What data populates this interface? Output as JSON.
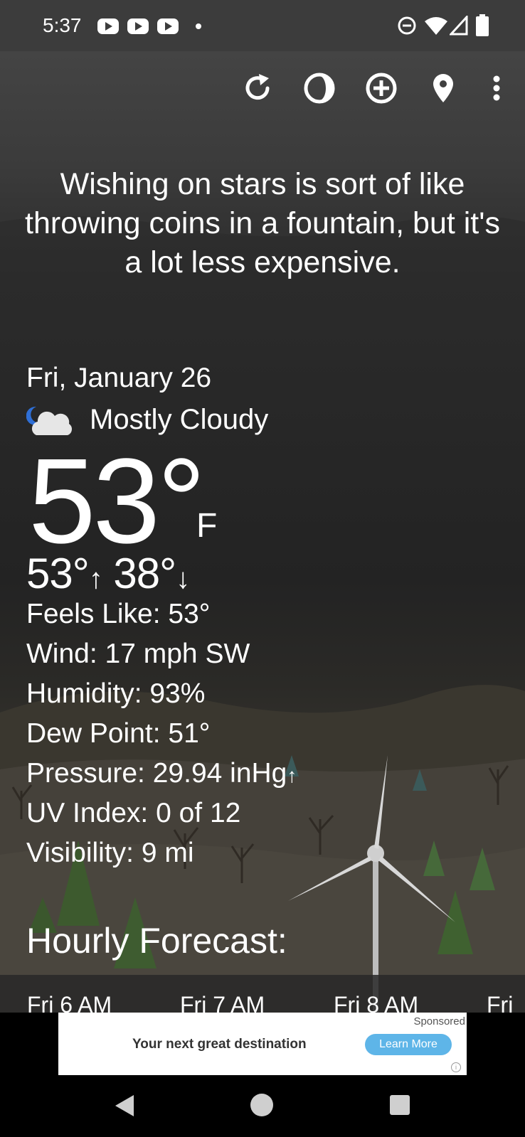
{
  "status_bar": {
    "time": "5:37",
    "notification_icons": [
      "youtube-icon",
      "youtube-icon",
      "youtube-icon",
      "dot-icon"
    ],
    "system_icons": [
      "do-not-disturb-icon",
      "wifi-icon",
      "signal-icon",
      "battery-icon"
    ]
  },
  "toolbar": {
    "icons": [
      "refresh-icon",
      "moon-phase-icon",
      "add-location-icon",
      "location-pin-icon",
      "more-options-icon"
    ]
  },
  "quote": "Wishing on stars is sort of like throwing coins in a fountain, but it's a lot less expensive.",
  "current": {
    "date": "Fri, January 26",
    "condition": "Mostly Cloudy",
    "condition_icon": "partly-cloudy-night-icon",
    "temperature": "53°",
    "unit": "F",
    "high": "53°",
    "low": "38°",
    "high_arrow": "↑",
    "low_arrow": "↓"
  },
  "details": {
    "feels_like": "Feels Like:  53°",
    "wind": "Wind:  17 mph SW",
    "humidity": "Humidity:  93%",
    "dew_point": "Dew Point:  51°",
    "pressure": "Pressure:  29.94 inHg",
    "pressure_trend": "↑",
    "uv_index": "UV Index:  0 of 12",
    "visibility": "Visibility:  9 mi"
  },
  "hourly": {
    "title": "Hourly Forecast:",
    "hours": [
      "Fri 6 AM",
      "Fri 7 AM",
      "Fri 8 AM",
      "Fri"
    ]
  },
  "ad": {
    "sponsored": "Sponsored",
    "headline": "Your next great destination",
    "cta": "Learn More"
  },
  "colors": {
    "status_bar_bg": "#3c3c3c",
    "ad_button": "#5eb5e8",
    "text": "#ffffff"
  }
}
